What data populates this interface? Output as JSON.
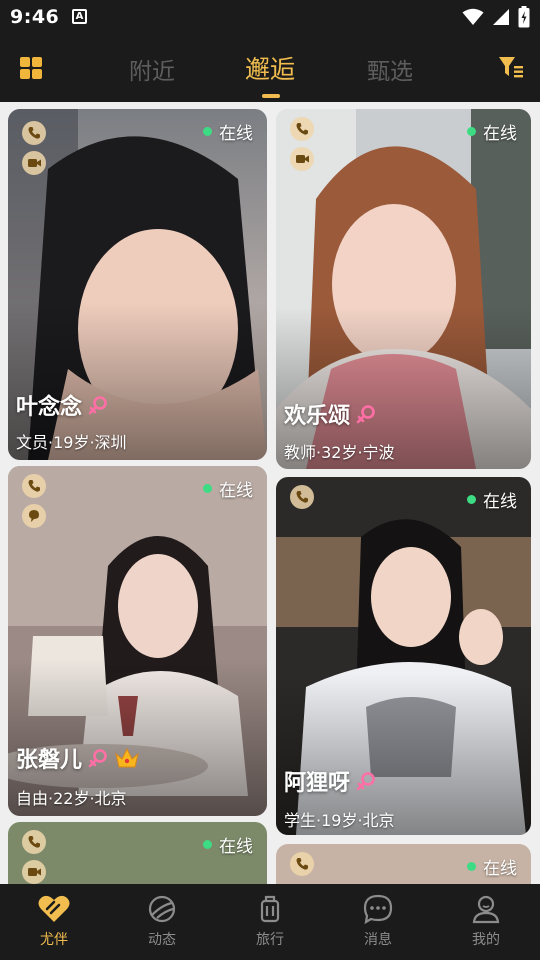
{
  "status_bar": {
    "time": "9:46",
    "notif": "A"
  },
  "top_nav": {
    "tabs": [
      {
        "label": "附近",
        "active": false
      },
      {
        "label": "邂逅",
        "active": true
      },
      {
        "label": "甄选",
        "active": false
      }
    ]
  },
  "accent_color": "#f0bd4e",
  "online_color": "#3ddc84",
  "cards": [
    {
      "name": "叶念念",
      "info": "文员·19岁·深圳",
      "status": "在线",
      "gender": "female",
      "badges": [
        "phone-icon",
        "video-icon"
      ],
      "crown": false
    },
    {
      "name": "欢乐颂",
      "info": "教师·32岁·宁波",
      "status": "在线",
      "gender": "female",
      "badges": [
        "phone-icon",
        "video-icon"
      ],
      "crown": false
    },
    {
      "name": "张磐儿",
      "info": "自由·22岁·北京",
      "status": "在线",
      "gender": "female",
      "badges": [
        "phone-icon",
        "chat-bubble-icon"
      ],
      "crown": true
    },
    {
      "name": "阿狸呀",
      "info": "学生·19岁·北京",
      "status": "在线",
      "gender": "female",
      "badges": [
        "phone-icon"
      ],
      "crown": false
    },
    {
      "name": "",
      "info": "",
      "status": "在线",
      "gender": "",
      "badges": [
        "phone-icon",
        "video-icon"
      ],
      "crown": false
    },
    {
      "name": "",
      "info": "",
      "status": "在线",
      "gender": "",
      "badges": [
        "phone-icon"
      ],
      "crown": false
    }
  ],
  "bottom_nav": {
    "items": [
      {
        "label": "尤伴",
        "icon": "heart-icon",
        "active": true
      },
      {
        "label": "动态",
        "icon": "planet-icon",
        "active": false
      },
      {
        "label": "旅行",
        "icon": "suitcase-icon",
        "active": false
      },
      {
        "label": "消息",
        "icon": "message-icon",
        "active": false
      },
      {
        "label": "我的",
        "icon": "profile-icon",
        "active": false
      }
    ]
  }
}
